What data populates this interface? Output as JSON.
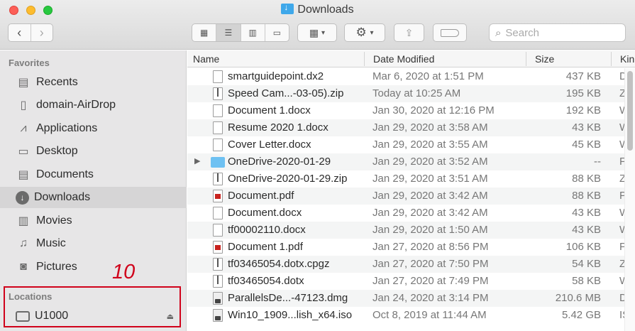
{
  "window": {
    "title": "Downloads"
  },
  "toolbar": {
    "back_icon": "chevron-left-icon",
    "forward_icon": "chevron-right-icon",
    "views": [
      "icon-view",
      "list-view",
      "column-view",
      "gallery-view"
    ],
    "active_view": "list-view",
    "search_placeholder": "Search"
  },
  "sidebar": {
    "favorites_heading": "Favorites",
    "favorites": [
      {
        "label": "Recents",
        "icon": "clock-icon"
      },
      {
        "label": "domain-AirDrop",
        "icon": "document-icon"
      },
      {
        "label": "Applications",
        "icon": "applications-icon"
      },
      {
        "label": "Desktop",
        "icon": "desktop-icon"
      },
      {
        "label": "Documents",
        "icon": "documents-icon"
      },
      {
        "label": "Downloads",
        "icon": "downloads-icon",
        "selected": true
      },
      {
        "label": "Movies",
        "icon": "film-icon"
      },
      {
        "label": "Music",
        "icon": "music-note-icon"
      },
      {
        "label": "Pictures",
        "icon": "camera-icon"
      }
    ],
    "locations_heading": "Locations",
    "locations": [
      {
        "label": "U1000",
        "icon": "drive-icon"
      }
    ]
  },
  "annotation": {
    "number": "10",
    "color": "#d0021b"
  },
  "columns": {
    "name": "Name",
    "date": "Date Modified",
    "size": "Size",
    "kind": "Kin"
  },
  "files": [
    {
      "name": "smartguidepoint.dx2",
      "date": "Mar 6, 2020 at 1:51 PM",
      "size": "437 KB",
      "kind": "Do",
      "type": "doc"
    },
    {
      "name": "Speed Cam...-03-05).zip",
      "date": "Today at 10:25 AM",
      "size": "195 KB",
      "kind": "ZIP",
      "type": "zip"
    },
    {
      "name": "Document 1.docx",
      "date": "Jan 30, 2020 at 12:16 PM",
      "size": "192 KB",
      "kind": "Wo",
      "type": "doc"
    },
    {
      "name": "Resume 2020 1.docx",
      "date": "Jan 29, 2020 at 3:58 AM",
      "size": "43 KB",
      "kind": "Wo",
      "type": "doc"
    },
    {
      "name": "Cover Letter.docx",
      "date": "Jan 29, 2020 at 3:55 AM",
      "size": "45 KB",
      "kind": "Wo",
      "type": "doc"
    },
    {
      "name": "OneDrive-2020-01-29",
      "date": "Jan 29, 2020 at 3:52 AM",
      "size": "--",
      "kind": "Fol",
      "type": "folder"
    },
    {
      "name": "OneDrive-2020-01-29.zip",
      "date": "Jan 29, 2020 at 3:51 AM",
      "size": "88 KB",
      "kind": "ZIP",
      "type": "zip"
    },
    {
      "name": "Document.pdf",
      "date": "Jan 29, 2020 at 3:42 AM",
      "size": "88 KB",
      "kind": "PD",
      "type": "pdf"
    },
    {
      "name": "Document.docx",
      "date": "Jan 29, 2020 at 3:42 AM",
      "size": "43 KB",
      "kind": "Wo",
      "type": "doc"
    },
    {
      "name": "tf00002110.docx",
      "date": "Jan 29, 2020 at 1:50 AM",
      "size": "43 KB",
      "kind": "Wo",
      "type": "doc"
    },
    {
      "name": "Document 1.pdf",
      "date": "Jan 27, 2020 at 8:56 PM",
      "size": "106 KB",
      "kind": "PD",
      "type": "pdf"
    },
    {
      "name": "tf03465054.dotx.cpgz",
      "date": "Jan 27, 2020 at 7:50 PM",
      "size": "54 KB",
      "kind": "ZIP",
      "type": "zip"
    },
    {
      "name": "tf03465054.dotx",
      "date": "Jan 27, 2020 at 7:49 PM",
      "size": "58 KB",
      "kind": "Wo",
      "type": "zip"
    },
    {
      "name": "ParallelsDe...-47123.dmg",
      "date": "Jan 24, 2020 at 3:14 PM",
      "size": "210.6 MB",
      "kind": "Dis",
      "type": "disk"
    },
    {
      "name": "Win10_1909...lish_x64.iso",
      "date": "Oct 8, 2019 at 11:44 AM",
      "size": "5.42 GB",
      "kind": "ISO",
      "type": "disk"
    }
  ]
}
